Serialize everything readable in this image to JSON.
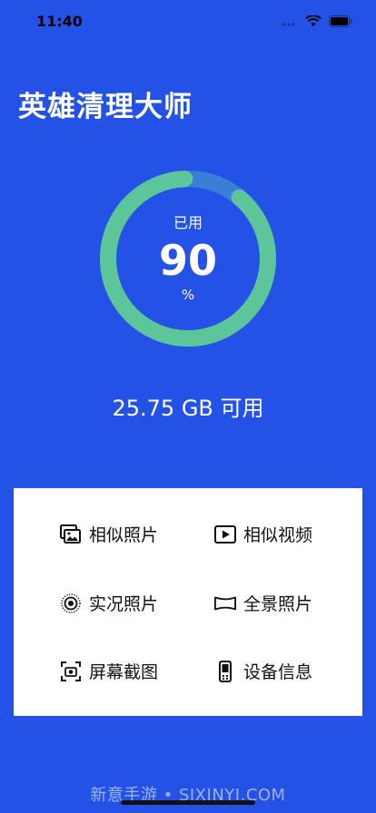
{
  "status": {
    "time": "11:40"
  },
  "app": {
    "title": "英雄清理大师"
  },
  "storage": {
    "used_label": "已用",
    "used_percent": 90,
    "used_percent_text": "90",
    "unit": "%",
    "available_text": "25.75 GB 可用"
  },
  "menu": {
    "similar_photos": "相似照片",
    "similar_videos": "相似视频",
    "live_photos": "实况照片",
    "panorama_photos": "全景照片",
    "screenshots": "屏幕截图",
    "device_info": "设备信息"
  },
  "watermark": "新意手游 • SJXINYI.COM",
  "colors": {
    "background": "#2552e6",
    "gauge_fill": "#5cc59a",
    "gauge_track": "#3a7fd6",
    "card": "#ffffff"
  }
}
